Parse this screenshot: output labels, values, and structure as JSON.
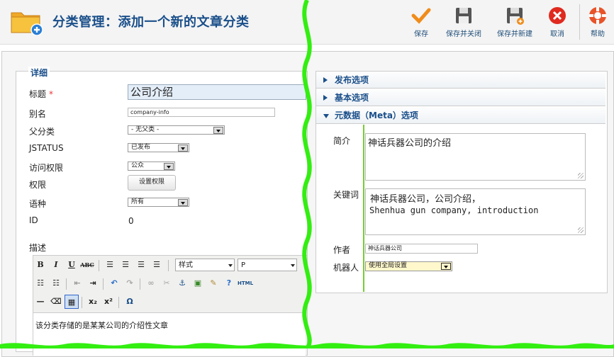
{
  "header": {
    "title": "分类管理：添加一个新的文章分类",
    "toolbar": {
      "save": "保存",
      "save_close": "保存并关闭",
      "save_new": "保存并新建",
      "cancel": "取消",
      "help": "帮助"
    }
  },
  "details": {
    "legend": "详细",
    "title_label": "标题",
    "required_mark": "*",
    "title_value": "公司介绍",
    "alias_label": "别名",
    "alias_value": "company-info",
    "parent_label": "父分类",
    "parent_value": "- 无父类 -",
    "status_label": "JSTATUS",
    "status_value": "已发布",
    "access_label": "访问权限",
    "access_value": "公众",
    "permissions_label": "权限",
    "permissions_button": "设置权限",
    "language_label": "语种",
    "language_value": "所有",
    "id_label": "ID",
    "id_value": "0",
    "description_label": "描述"
  },
  "editor": {
    "style_select": "样式",
    "format_select": "P",
    "html_label": "HTML",
    "body_text": "该分类存储的是某某公司的介绍性文章"
  },
  "accordion": {
    "publish": "发布选项",
    "basic": "基本选项",
    "meta": "元数据（Meta）选项"
  },
  "meta": {
    "desc_label": "简介",
    "desc_value": "神话兵器公司的介绍",
    "keywords_label": "关键词",
    "keywords_line1": "神话兵器公司，公司介绍，",
    "keywords_line2": "Shenhua gun company, introduction",
    "author_label": "作者",
    "author_value": "神话兵器公司",
    "robots_label": "机器人",
    "robots_value": "使用全局设置"
  },
  "colors": {
    "title_blue": "#1a4f8a",
    "wave_green": "#33ee11"
  }
}
